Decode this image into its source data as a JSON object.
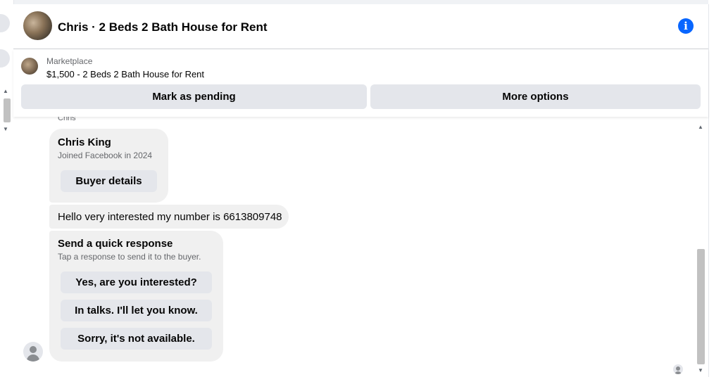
{
  "header": {
    "title": "Chris · 2 Beds 2 Bath House for Rent",
    "info_icon": "info-icon",
    "info_glyph": "i",
    "accent_color": "#0866ff"
  },
  "listing": {
    "category": "Marketplace",
    "price_title": "$1,500 - 2 Beds 2 Bath House for Rent",
    "mark_pending_label": "Mark as pending",
    "more_options_label": "More options"
  },
  "chat": {
    "sender_label": "Chris",
    "profile_card": {
      "name": "Chris King",
      "joined": "Joined Facebook in 2024",
      "button_label": "Buyer details"
    },
    "message": "Hello very interested my number is 6613809748",
    "quick_response": {
      "heading": "Send a quick response",
      "subheading": "Tap a response to send it to the buyer.",
      "options": [
        "Yes, are you interested?",
        "In talks. I'll let you know.",
        "Sorry, it's not available."
      ]
    }
  },
  "scrollbars": {
    "up_arrow": "▲",
    "down_arrow": "▼"
  }
}
